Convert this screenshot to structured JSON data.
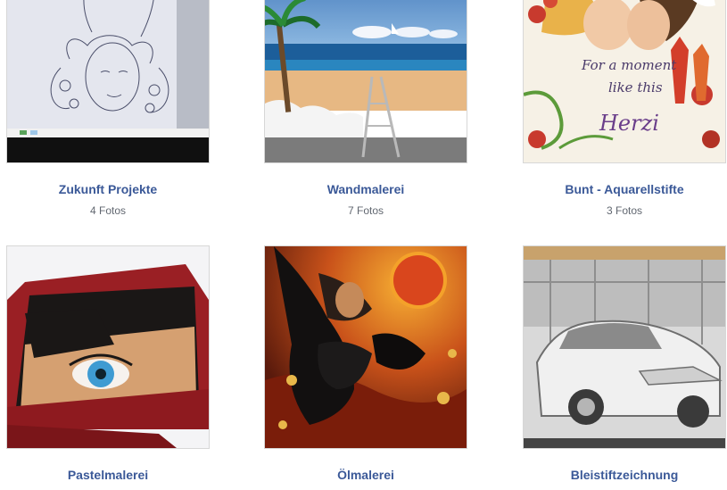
{
  "albums": [
    {
      "title": "Zukunft Projekte",
      "count": "4 Fotos"
    },
    {
      "title": "Wandmalerei",
      "count": "7 Fotos"
    },
    {
      "title": "Bunt - Aquarellstifte",
      "count": "3 Fotos"
    },
    {
      "title": "Pastelmalerei",
      "count": ""
    },
    {
      "title": "Ölmalerei",
      "count": ""
    },
    {
      "title": "Bleistiftzeichnung",
      "count": ""
    }
  ],
  "artwork_text": {
    "watercolor_line1": "For a moment",
    "watercolor_line2": "like this",
    "watercolor_signature": "Herzi"
  }
}
